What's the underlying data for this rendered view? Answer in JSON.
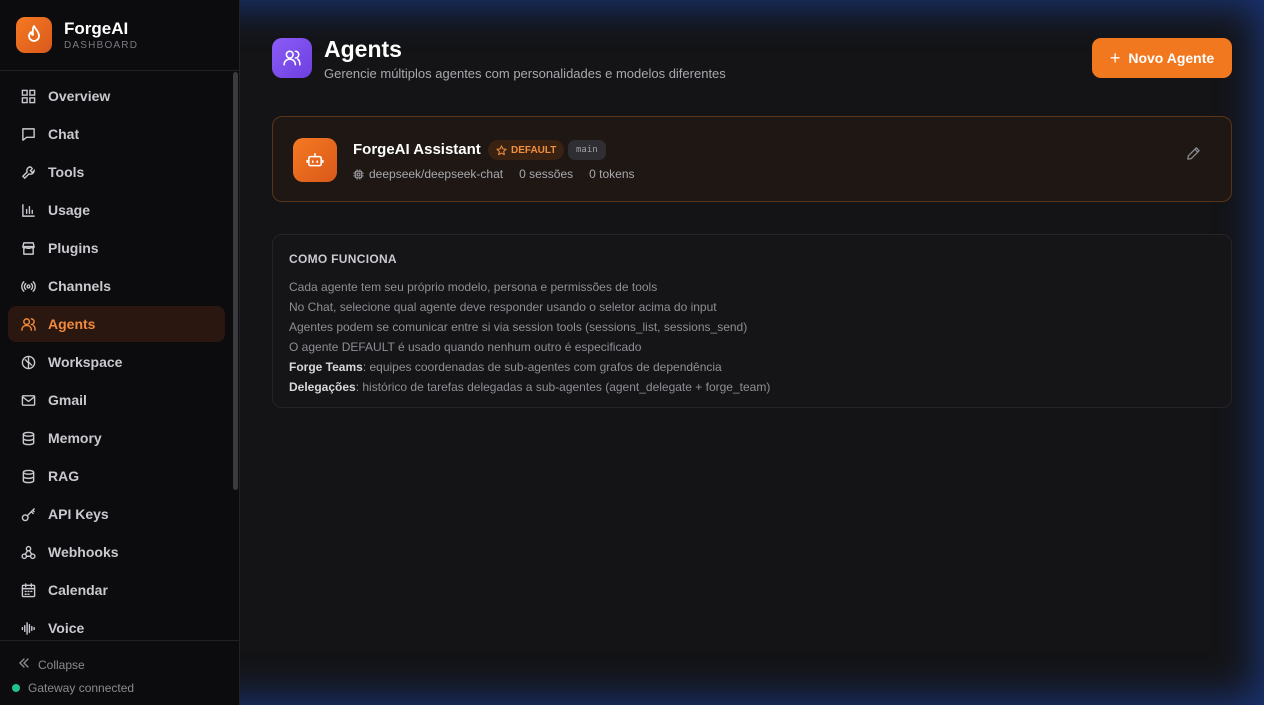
{
  "brand": {
    "title": "ForgeAI",
    "subtitle": "DASHBOARD",
    "accent": "#f2781f"
  },
  "sidebar": {
    "items": [
      {
        "label": "Overview",
        "icon": "grid-icon",
        "active": false
      },
      {
        "label": "Chat",
        "icon": "chat-icon",
        "active": false
      },
      {
        "label": "Tools",
        "icon": "wrench-icon",
        "active": false
      },
      {
        "label": "Usage",
        "icon": "bar-chart-icon",
        "active": false
      },
      {
        "label": "Plugins",
        "icon": "store-icon",
        "active": false
      },
      {
        "label": "Channels",
        "icon": "broadcast-icon",
        "active": false
      },
      {
        "label": "Agents",
        "icon": "users-icon",
        "active": true
      },
      {
        "label": "Workspace",
        "icon": "brain-icon",
        "active": false
      },
      {
        "label": "Gmail",
        "icon": "mail-icon",
        "active": false
      },
      {
        "label": "Memory",
        "icon": "database-icon",
        "active": false
      },
      {
        "label": "RAG",
        "icon": "database-icon",
        "active": false
      },
      {
        "label": "API Keys",
        "icon": "key-icon",
        "active": false
      },
      {
        "label": "Webhooks",
        "icon": "webhook-icon",
        "active": false
      },
      {
        "label": "Calendar",
        "icon": "calendar-icon",
        "active": false
      },
      {
        "label": "Voice",
        "icon": "audio-wave-icon",
        "active": false
      }
    ],
    "collapse_label": "Collapse",
    "status_label": "Gateway connected",
    "status_color": "#22c08a"
  },
  "header": {
    "title": "Agents",
    "subtitle": "Gerencie múltiplos agentes com personalidades e modelos diferentes",
    "new_button": "Novo Agente"
  },
  "agent": {
    "name": "ForgeAI Assistant",
    "badge_default": "DEFAULT",
    "badge_id": "main",
    "model": "deepseek/deepseek-chat",
    "sessions": "0 sessões",
    "tokens": "0 tokens"
  },
  "how": {
    "title": "COMO FUNCIONA",
    "lines": [
      "Cada agente tem seu próprio modelo, persona e permissões de tools",
      "No Chat, selecione qual agente deve responder usando o seletor acima do input",
      "Agentes podem se comunicar entre si via session tools (sessions_list, sessions_send)",
      "O agente DEFAULT é usado quando nenhum outro é especificado"
    ],
    "teams_label": "Forge Teams",
    "teams_text": ": equipes coordenadas de sub-agentes com grafos de dependência",
    "delegations_label": "Delegações",
    "delegations_text": ": histórico de tarefas delegadas a sub-agentes (agent_delegate + forge_team)"
  }
}
